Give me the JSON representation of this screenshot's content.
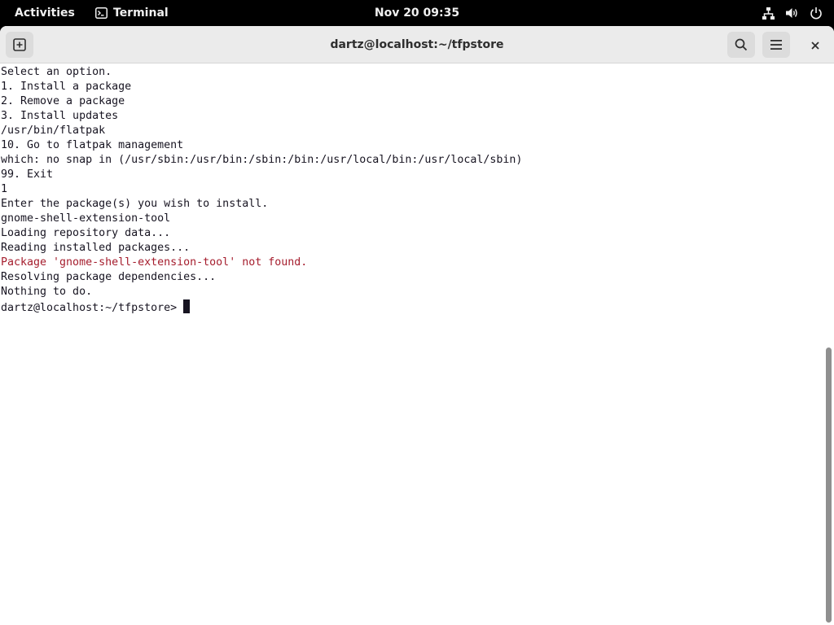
{
  "topbar": {
    "activities": "Activities",
    "app_name": "Terminal",
    "clock": "Nov 20  09:35",
    "status_icons": [
      "network-icon",
      "volume-icon",
      "power-icon"
    ]
  },
  "window": {
    "title": "dartz@localhost:~/tfpstore",
    "buttons": [
      "new-tab-icon",
      "search-icon",
      "menu-icon",
      "close-icon"
    ]
  },
  "terminal": {
    "lines": [
      {
        "text": "Select an option.",
        "style": "normal"
      },
      {
        "text": "1. Install a package",
        "style": "normal"
      },
      {
        "text": "2. Remove a package",
        "style": "normal"
      },
      {
        "text": "3. Install updates",
        "style": "normal"
      },
      {
        "text": "/usr/bin/flatpak",
        "style": "normal"
      },
      {
        "text": "10. Go to flatpak management",
        "style": "normal"
      },
      {
        "text": "which: no snap in (/usr/sbin:/usr/bin:/sbin:/bin:/usr/local/bin:/usr/local/sbin)",
        "style": "normal"
      },
      {
        "text": "99. Exit",
        "style": "normal"
      },
      {
        "text": "1",
        "style": "normal"
      },
      {
        "text": "Enter the package(s) you wish to install.",
        "style": "normal"
      },
      {
        "text": "gnome-shell-extension-tool",
        "style": "normal"
      },
      {
        "text": "Loading repository data...",
        "style": "normal"
      },
      {
        "text": "Reading installed packages...",
        "style": "normal"
      },
      {
        "text": "Package 'gnome-shell-extension-tool' not found.",
        "style": "error"
      },
      {
        "text": "Resolving package dependencies...",
        "style": "normal"
      },
      {
        "text": "Nothing to do.",
        "style": "normal"
      }
    ],
    "prompt": "dartz@localhost:~/tfpstore>",
    "colors": {
      "foreground": "#171421",
      "error": "#a51d2d",
      "background": "#ffffff"
    }
  }
}
